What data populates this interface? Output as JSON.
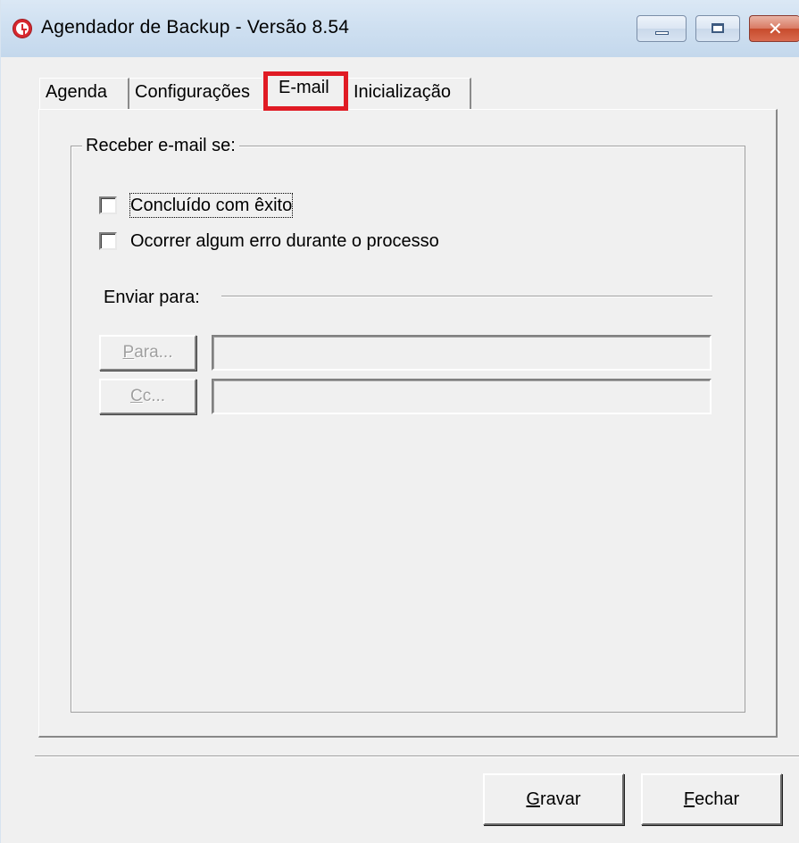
{
  "window": {
    "title": "Agendador de Backup - Versão 8.54",
    "icon": "clock-icon"
  },
  "caption_buttons": {
    "minimize": "minimize-icon",
    "maximize": "maximize-icon",
    "close": "close-icon"
  },
  "tabs": [
    {
      "label": "Agenda",
      "selected": false
    },
    {
      "label": "Configurações",
      "selected": false
    },
    {
      "label": "E-mail",
      "selected": true
    },
    {
      "label": "Inicialização",
      "selected": false
    }
  ],
  "email_page": {
    "group_title": "Receber e-mail se:",
    "checkboxes": [
      {
        "label": "Concluído com êxito",
        "checked": false
      },
      {
        "label": "Ocorrer algum erro durante o processo",
        "checked": false
      }
    ],
    "send_to_label": "Enviar para:",
    "to_button": {
      "label": "Para...",
      "enabled": false
    },
    "to_value": "",
    "cc_button": {
      "label": "Cc...",
      "enabled": false
    },
    "cc_value": ""
  },
  "footer": {
    "save_label": "Gravar",
    "close_label": "Fechar"
  },
  "colors": {
    "highlight": "#e01b24",
    "window_bg": "#f0f0f0"
  }
}
